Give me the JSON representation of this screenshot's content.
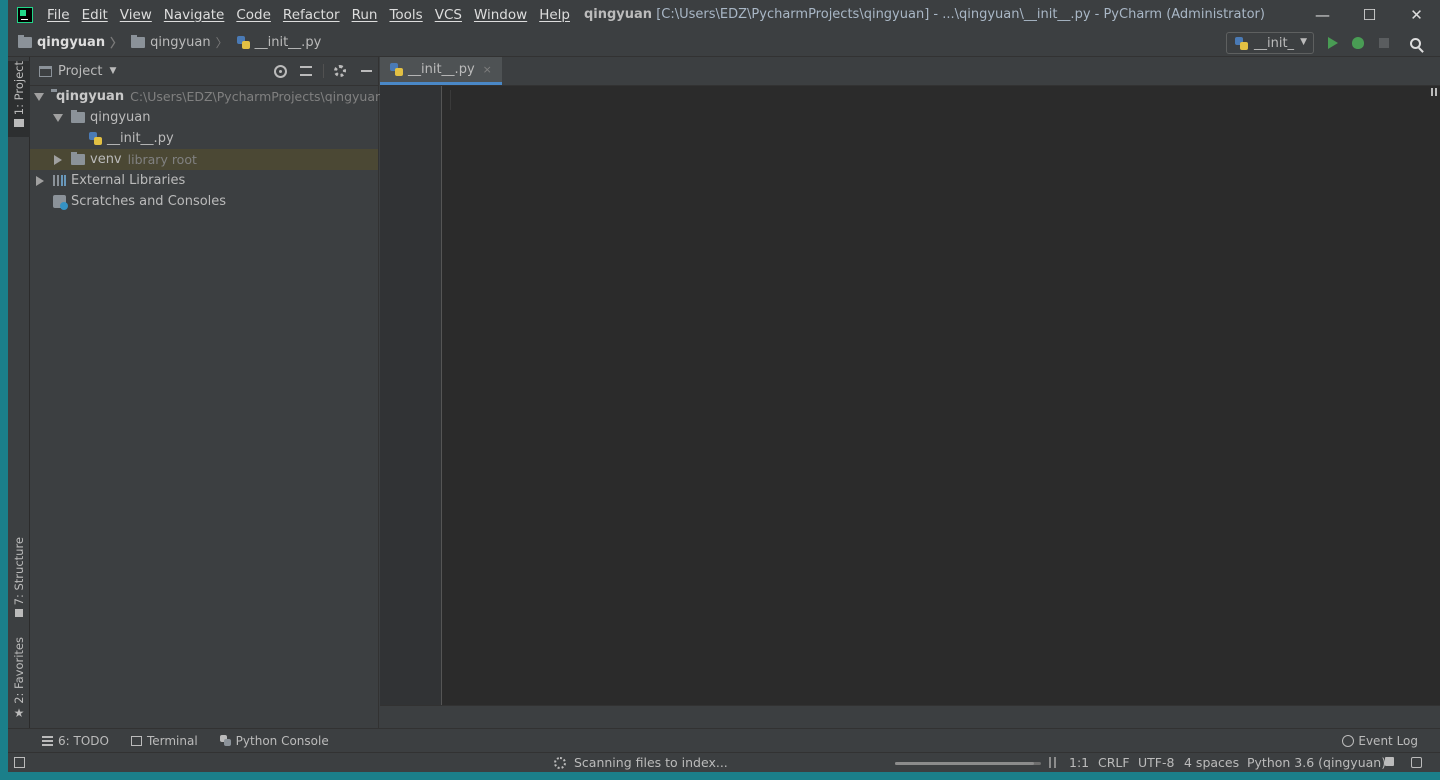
{
  "window": {
    "menu": [
      "File",
      "Edit",
      "View",
      "Navigate",
      "Code",
      "Refactor",
      "Run",
      "Tools",
      "VCS",
      "Window",
      "Help"
    ],
    "title_project": "qingyuan",
    "title_rest": "[C:\\Users\\EDZ\\PycharmProjects\\qingyuan] - ...\\qingyuan\\__init__.py - PyCharm (Administrator)",
    "controls": {
      "minimize": "—",
      "maximize": "☐",
      "close": "✕"
    }
  },
  "navbar": {
    "breadcrumbs": [
      "qingyuan",
      "qingyuan",
      "__init__.py"
    ],
    "separator": "〉",
    "run_config": "__init_"
  },
  "left_stripe": {
    "project_tab": "1: Project",
    "structure_tab": "7: Structure",
    "favorites_tab": "2: Favorites"
  },
  "project_panel": {
    "title": "Project",
    "tree": {
      "root_name": "qingyuan",
      "root_path": "C:\\Users\\EDZ\\PycharmProjects\\qingyuan",
      "package_name": "qingyuan",
      "file_name": "__init__.py",
      "venv_name": "venv",
      "venv_hint": "library root",
      "external_libraries": "External Libraries",
      "scratches": "Scratches and Consoles"
    }
  },
  "editor": {
    "tab_label": "__init__.py",
    "tab_close": "×"
  },
  "bottom_tools": {
    "todo": "6: TODO",
    "terminal": "Terminal",
    "python_console": "Python Console",
    "event_log": "Event Log"
  },
  "statusbar": {
    "scanning": "Scanning files to index...",
    "progress": 0.95,
    "position": "1:1",
    "line_separator": "CRLF",
    "encoding": "UTF-8",
    "indent": "4 spaces",
    "interpreter": "Python 3.6 (qingyuan)"
  },
  "colors": {
    "background": "#3c3f41",
    "editor": "#2b2b2b",
    "accent": "#4a88c7",
    "run_green": "#499c54",
    "selection": "#4b4834"
  }
}
